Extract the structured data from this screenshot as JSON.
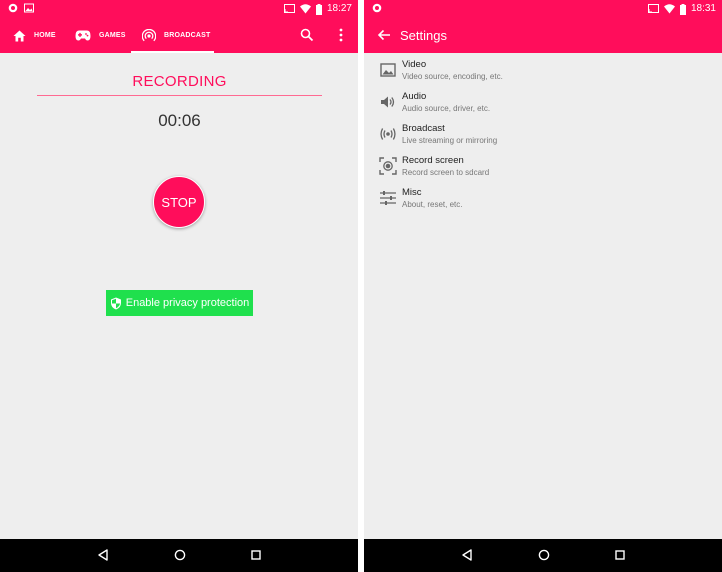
{
  "left": {
    "status_time": "18:27",
    "tabs": [
      {
        "label": "HOME"
      },
      {
        "label": "GAMES"
      },
      {
        "label": "BROADCAST"
      }
    ],
    "recording_title": "RECORDING",
    "timer": "00:06",
    "stop_label": "STOP",
    "privacy_label": "Enable privacy protection"
  },
  "right": {
    "status_time": "18:31",
    "title": "Settings",
    "items": [
      {
        "title": "Video",
        "subtitle": "Video source, encoding, etc."
      },
      {
        "title": "Audio",
        "subtitle": "Audio source, driver, etc."
      },
      {
        "title": "Broadcast",
        "subtitle": "Live streaming or mirroring"
      },
      {
        "title": "Record screen",
        "subtitle": "Record screen to sdcard"
      },
      {
        "title": "Misc",
        "subtitle": "About, reset, etc."
      }
    ]
  },
  "icons": {
    "left_status": [
      "record-indicator-icon",
      "image-icon",
      "cast-icon",
      "wifi-icon",
      "battery-icon"
    ],
    "tabs": [
      "home-icon",
      "gamepad-icon",
      "broadcast-icon"
    ],
    "actions": [
      "search-icon",
      "more-vert-icon"
    ],
    "privacy": "shield-icon",
    "settings": [
      "image-icon",
      "volume-icon",
      "broadcast-icon",
      "record-screen-icon",
      "tune-icon"
    ],
    "nav": [
      "back-icon",
      "home-circle-icon",
      "recents-icon"
    ]
  },
  "colors": {
    "accent": "#ff0d5b",
    "privacy_green": "#1fe04d",
    "background": "#eeeeee",
    "nav_bar": "#000000"
  }
}
